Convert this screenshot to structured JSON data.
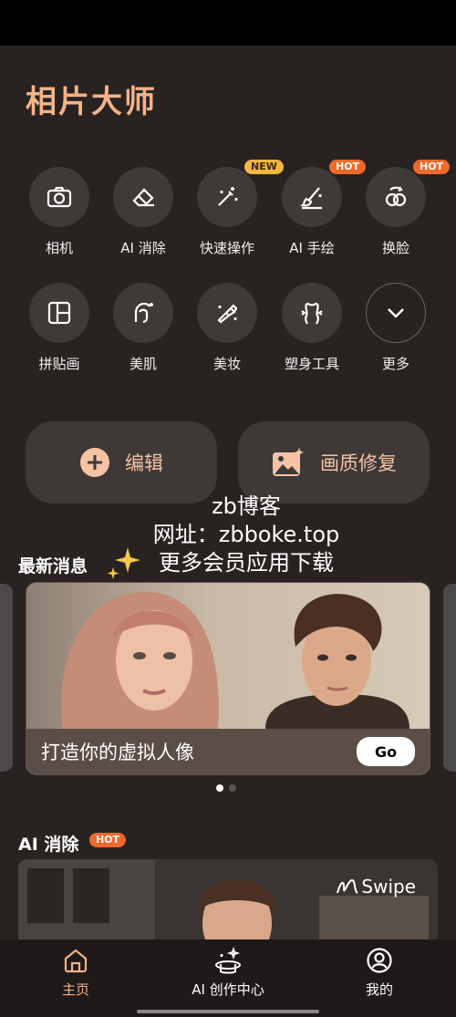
{
  "app": {
    "title": "相片大师"
  },
  "tools": [
    {
      "label": "相机",
      "icon": "camera-icon"
    },
    {
      "label": "AI 消除",
      "icon": "eraser-icon"
    },
    {
      "label": "快速操作",
      "icon": "magic-wand-icon",
      "badge": "NEW"
    },
    {
      "label": "AI 手绘",
      "icon": "brush-icon",
      "badge": "HOT"
    },
    {
      "label": "换脸",
      "icon": "face-swap-icon",
      "badge": "HOT"
    },
    {
      "label": "拼贴画",
      "icon": "collage-icon"
    },
    {
      "label": "美肌",
      "icon": "face-beauty-icon"
    },
    {
      "label": "美妆",
      "icon": "lipstick-icon"
    },
    {
      "label": "塑身工具",
      "icon": "body-shape-icon"
    },
    {
      "label": "更多",
      "icon": "chevron-down-icon"
    }
  ],
  "actions": {
    "edit": "编辑",
    "restore": "画质修复"
  },
  "watermark": {
    "line1": "zb博客",
    "line2": "网址：zbboke.top",
    "line3": "更多会员应用下载"
  },
  "news": {
    "title": "最新消息",
    "banner_caption": "打造你的虚拟人像",
    "banner_button": "Go",
    "dots_total": 2,
    "dots_active": 1
  },
  "ai_erase": {
    "title": "AI 消除",
    "badge": "HOT",
    "swipe": "Swipe"
  },
  "nav": {
    "home": "主页",
    "ai_center": "AI 创作中心",
    "me": "我的"
  },
  "colors": {
    "background": "#282321",
    "title_accent": "#f4b38a",
    "action_text": "#f6c3a5",
    "hot_badge": "#ee6a2a",
    "new_badge": "#f1b640",
    "nav_active": "#f4b38a"
  }
}
